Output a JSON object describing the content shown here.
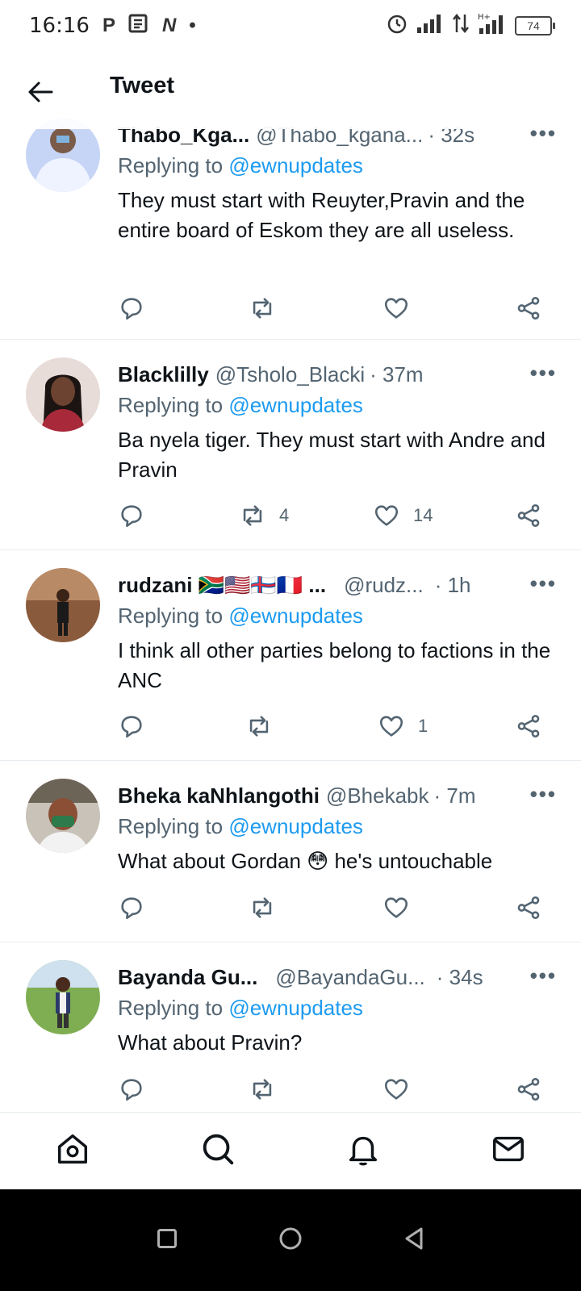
{
  "status_bar": {
    "time": "16:16",
    "left_icons": [
      "P",
      "news",
      "N",
      "•"
    ],
    "battery": "74"
  },
  "header": {
    "title": "Tweet"
  },
  "replying_prefix": "Replying to",
  "tweets": [
    {
      "name": "Thabo_Kga...",
      "handle": "@Thabo_kgana...",
      "time": "· 32s",
      "replying_to": "@ewnupdates",
      "text": "They must start with Reuyter,Pravin and the entire board of Eskom they are all useless.",
      "retweets": "",
      "likes": "",
      "avatar_color": "#b9c8ef"
    },
    {
      "name": "Blacklilly",
      "handle": "@Tsholo_Blacki",
      "time": "· 37m",
      "replying_to": "@ewnupdates",
      "text": "Ba nyela tiger. They must start with Andre and Pravin",
      "retweets": "4",
      "likes": "14",
      "avatar_color": "#d6c5c2"
    },
    {
      "name": "rudzani 🇿🇦🇺🇸🇫🇴🇫🇷 ...",
      "handle": "@rudz...",
      "time": "· 1h",
      "replying_to": "@ewnupdates",
      "text": "I think all other parties belong to factions in the ANC",
      "retweets": "",
      "likes": "1",
      "avatar_color": "#8a5a3c"
    },
    {
      "name": "Bheka kaNhlangothi",
      "handle": "@Bhekabk",
      "time": "· 7m",
      "replying_to": "@ewnupdates",
      "text": "What about Gordan 😳 he's untouchable",
      "retweets": "",
      "likes": "",
      "avatar_color": "#7a6f62"
    },
    {
      "name": "Bayanda Gu...",
      "handle": "@BayandaGu...",
      "time": "· 34s",
      "replying_to": "@ewnupdates",
      "text": "What about Pravin?",
      "retweets": "",
      "likes": "",
      "avatar_color": "#5f8a3a"
    }
  ],
  "colors": {
    "accent": "#1d9bf0",
    "secondary_text": "#536471",
    "divider": "#e6ecf0"
  },
  "bottom_nav": [
    "home-icon",
    "search-icon",
    "bell-icon",
    "mail-icon"
  ]
}
